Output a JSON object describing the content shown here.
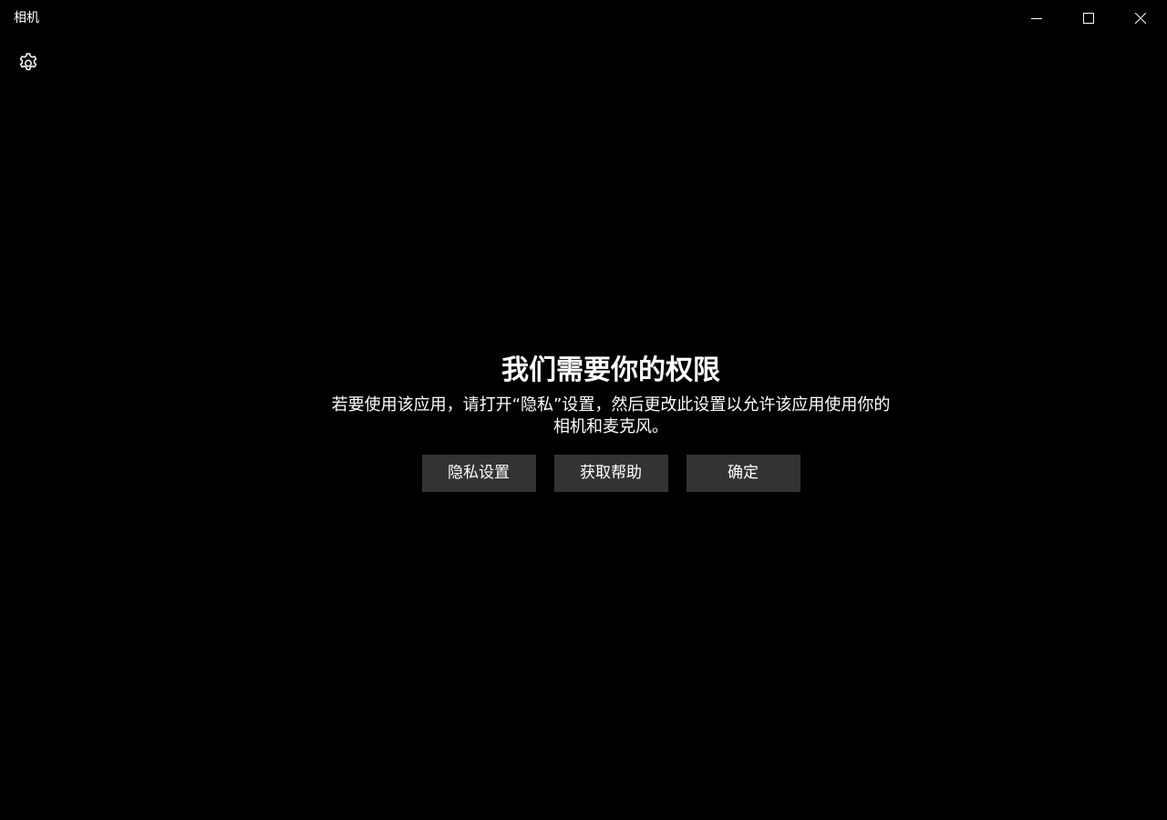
{
  "window": {
    "title": "相机"
  },
  "caption_buttons": {
    "minimize_icon": "minimize-icon",
    "maximize_icon": "maximize-icon",
    "close_icon": "close-icon"
  },
  "toolbar": {
    "settings_icon": "gear-icon"
  },
  "permission_dialog": {
    "title": "我们需要你的权限",
    "message": "若要使用该应用，请打开“隐私”设置，然后更改此设置以允许该应用使用你的相机和麦克风。",
    "buttons": [
      {
        "label": "隐私设置"
      },
      {
        "label": "获取帮助"
      },
      {
        "label": "确定"
      }
    ]
  },
  "colors": {
    "background": "#000000",
    "button_background": "#333333",
    "text": "#ffffff"
  }
}
